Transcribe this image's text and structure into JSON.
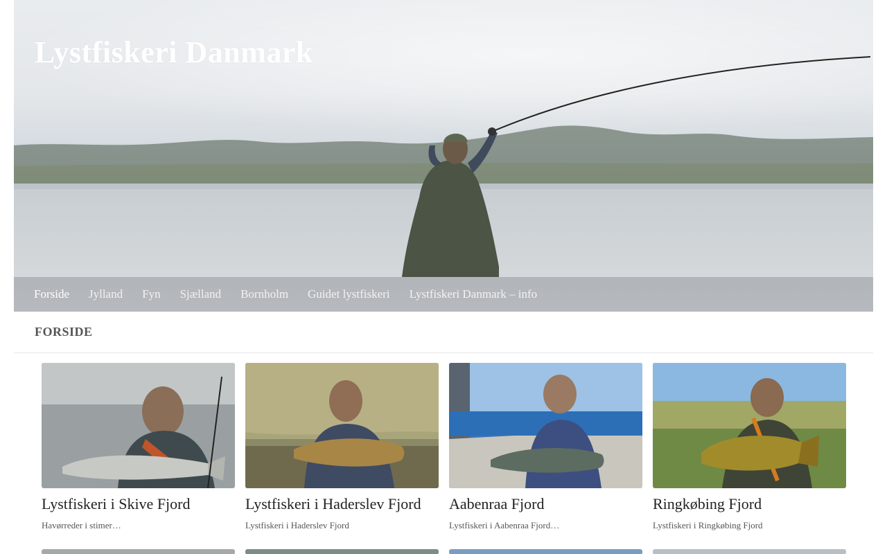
{
  "site": {
    "title": "Lystfiskeri Danmark"
  },
  "nav": {
    "items": [
      {
        "label": "Forside",
        "active": true
      },
      {
        "label": "Jylland"
      },
      {
        "label": "Fyn"
      },
      {
        "label": "Sjælland"
      },
      {
        "label": "Bornholm"
      },
      {
        "label": "Guidet lystfiskeri"
      },
      {
        "label": "Lystfiskeri Danmark – info"
      }
    ]
  },
  "page": {
    "heading": "FORSIDE"
  },
  "posts": [
    {
      "title": "Lystfiskeri i Skive Fjord",
      "excerpt": "Havørreder i stimer…"
    },
    {
      "title": "Lystfiskeri i Haderslev Fjord",
      "excerpt": "Lystfiskeri i Haderslev Fjord"
    },
    {
      "title": "Aabenraa Fjord",
      "excerpt": "Lystfiskeri i Aabenraa Fjord…"
    },
    {
      "title": "Ringkøbing Fjord",
      "excerpt": "Lystfiskeri i Ringkøbing Fjord"
    }
  ],
  "colors": {
    "nav_text": "#f3f3f3",
    "heading": "#555555",
    "title_text": "#222222"
  }
}
